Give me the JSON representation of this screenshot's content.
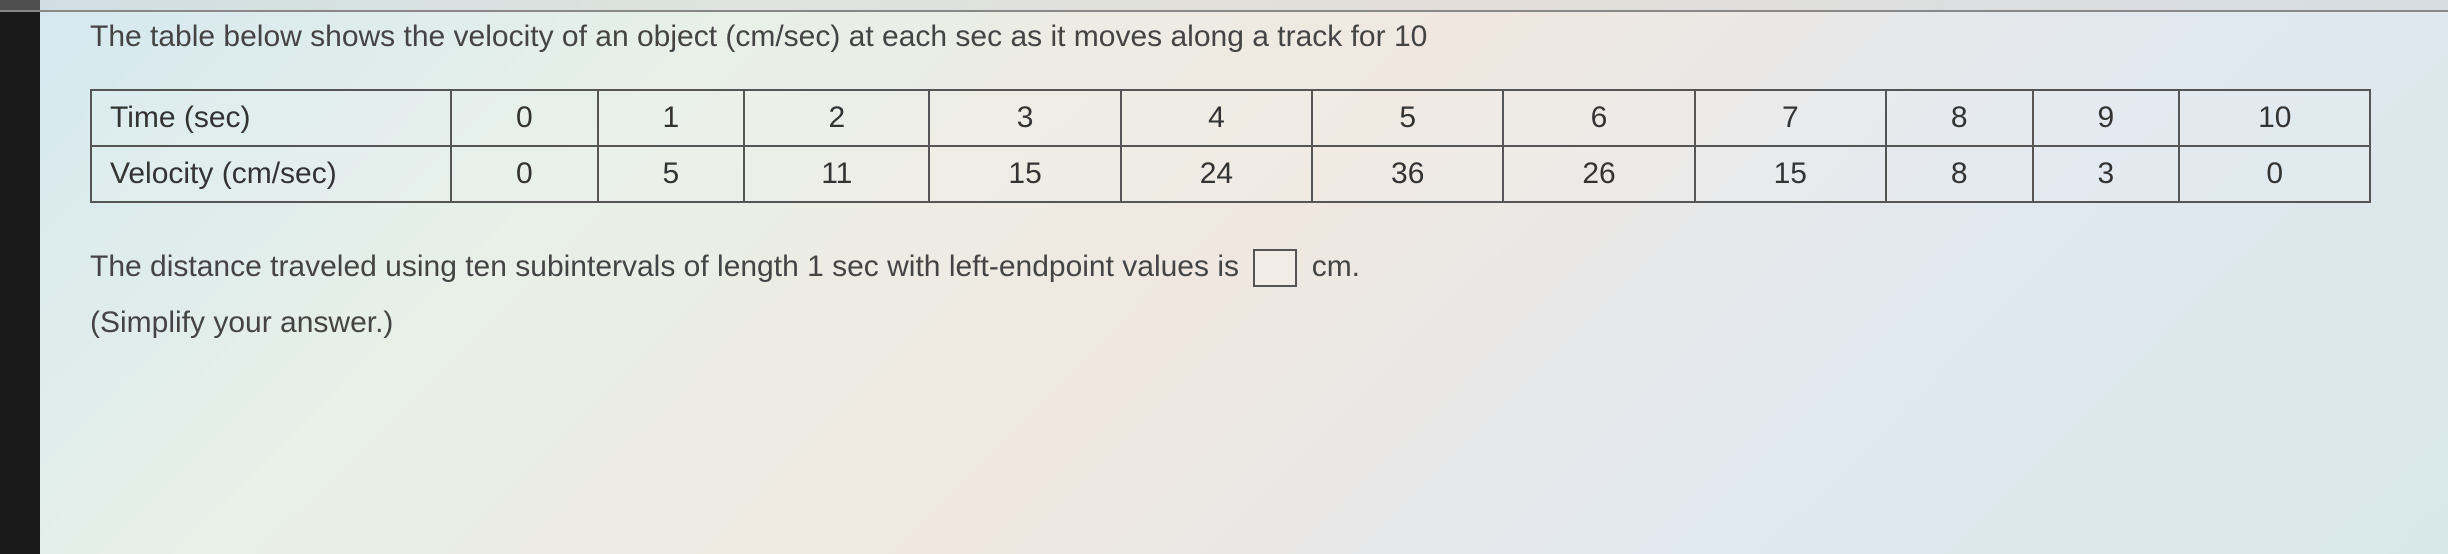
{
  "intro": "The table below shows the velocity of an object (cm/sec) at each sec as it moves along a track for 10",
  "table": {
    "row1_header": "Time (sec)",
    "row2_header": "Velocity (cm/sec)",
    "time": [
      "0",
      "1",
      "2",
      "3",
      "4",
      "5",
      "6",
      "7",
      "8",
      "9",
      "10"
    ],
    "velocity": [
      "0",
      "5",
      "11",
      "15",
      "24",
      "36",
      "26",
      "15",
      "8",
      "3",
      "0"
    ]
  },
  "question": {
    "text_before": "The distance traveled using ten subintervals of length 1 sec with left-endpoint values is",
    "unit": "cm.",
    "simplify": "(Simplify your answer.)"
  },
  "chart_data": {
    "type": "table",
    "title": "Velocity of an object (cm/sec) at each second",
    "columns": [
      "Time (sec)",
      "Velocity (cm/sec)"
    ],
    "rows": [
      [
        0,
        0
      ],
      [
        1,
        5
      ],
      [
        2,
        11
      ],
      [
        3,
        15
      ],
      [
        4,
        24
      ],
      [
        5,
        36
      ],
      [
        6,
        26
      ],
      [
        7,
        15
      ],
      [
        8,
        8
      ],
      [
        9,
        3
      ],
      [
        10,
        0
      ]
    ]
  }
}
